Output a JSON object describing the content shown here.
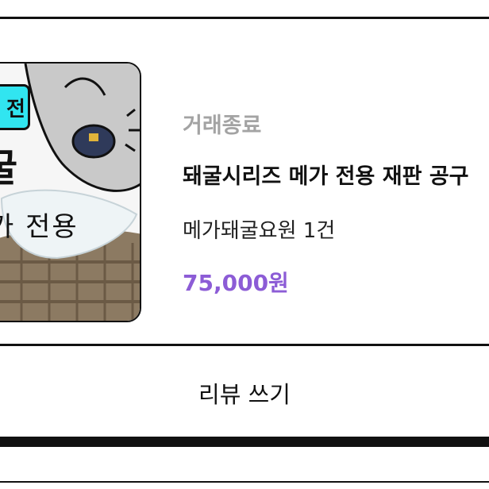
{
  "order": {
    "status": "거래종료",
    "title": "돼굴시리즈 메가 전용 재판 공구",
    "option": "메가돼굴요원 1건",
    "price": "75,000원",
    "thumbnail": {
      "badge_text": "전",
      "big_text": "굴",
      "sub_text": "가 전용"
    }
  },
  "actions": {
    "review_label": "리뷰 쓰기"
  },
  "colors": {
    "status": "#a3a3a3",
    "price": "#8c5cd6",
    "badge": "#31e5f0"
  }
}
